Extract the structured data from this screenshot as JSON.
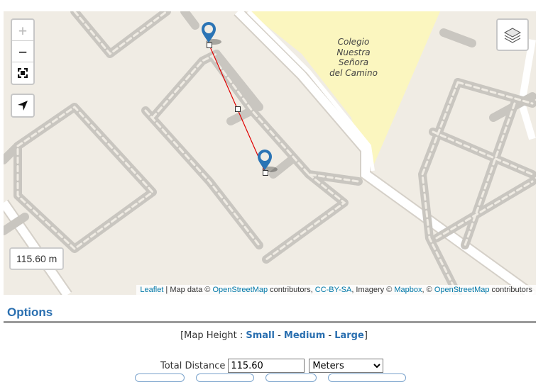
{
  "map": {
    "place_label_lines": [
      "Colegio",
      "Nuestra",
      "Señora",
      "del Camino"
    ],
    "distance_label": "115.60 m",
    "zoom_in": "+",
    "zoom_out": "−",
    "icons": [
      "plus-icon",
      "minus-icon",
      "fullscreen-icon",
      "location-arrow-icon",
      "layers-icon",
      "map-pin-icon"
    ],
    "colors": {
      "background": "#f0ece4",
      "street": "#ffffff",
      "footpath": "#d9d9d9",
      "school_area": "#fbf6bf",
      "measure_line": "#e00000",
      "pin": "#2b74b5"
    }
  },
  "attribution": {
    "leaflet": "Leaflet",
    "sep": " | ",
    "map_data": "Map data © ",
    "osm": "OpenStreetMap",
    "contributors": " contributors, ",
    "license": "CC-BY-SA",
    "imagery": ", Imagery © ",
    "mapbox": "Mapbox",
    "copy": ", © ",
    "osm2": "OpenStreetMap",
    "contributors2": " contributors"
  },
  "options": {
    "title": "Options",
    "map_height_prefix": "[Map Height : ",
    "small": "Small",
    "dash1": " - ",
    "medium": "Medium",
    "dash2": " - ",
    "large": "Large",
    "suffix": "]",
    "total_label": "Total Distance",
    "total_value": "115.60",
    "unit_selected": "Meters"
  }
}
